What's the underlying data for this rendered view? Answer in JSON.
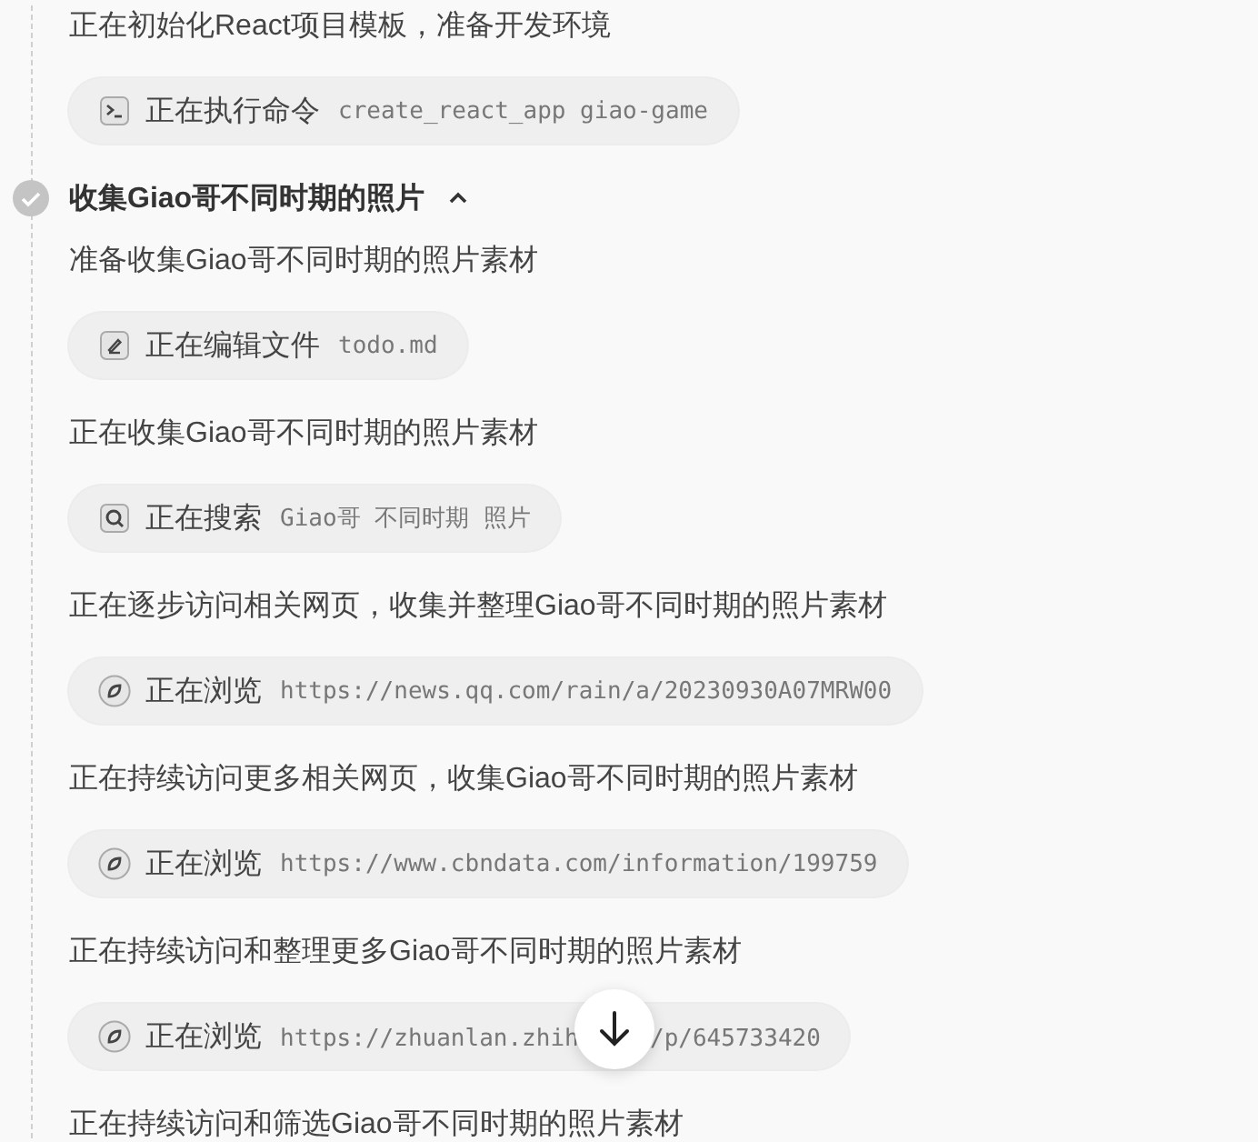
{
  "intro": {
    "text": "正在初始化React项目模板，准备开发环境",
    "action": {
      "kind": "terminal",
      "verb": "正在执行命令",
      "target": "create_react_app giao-game"
    }
  },
  "section": {
    "title": "收集Giao哥不同时期的照片",
    "done": true,
    "expanded": true,
    "items": [
      {
        "text": "准备收集Giao哥不同时期的照片素材",
        "action": {
          "kind": "edit",
          "verb": "正在编辑文件",
          "target": "todo.md"
        }
      },
      {
        "text": "正在收集Giao哥不同时期的照片素材",
        "action": {
          "kind": "search",
          "verb": "正在搜索",
          "target": "Giao哥 不同时期 照片"
        }
      },
      {
        "text": "正在逐步访问相关网页，收集并整理Giao哥不同时期的照片素材",
        "action": {
          "kind": "browse",
          "verb": "正在浏览",
          "target": "https://news.qq.com/rain/a/20230930A07MRW00"
        }
      },
      {
        "text": "正在持续访问更多相关网页，收集Giao哥不同时期的照片素材",
        "action": {
          "kind": "browse",
          "verb": "正在浏览",
          "target": "https://www.cbndata.com/information/199759"
        }
      },
      {
        "text": "正在持续访问和整理更多Giao哥不同时期的照片素材",
        "action": {
          "kind": "browse",
          "verb": "正在浏览",
          "target": "https://zhuanlan.zhih",
          "target_rest": "/p/645733420"
        }
      },
      {
        "text": "正在持续访问和筛选Giao哥不同时期的照片素材"
      }
    ]
  }
}
